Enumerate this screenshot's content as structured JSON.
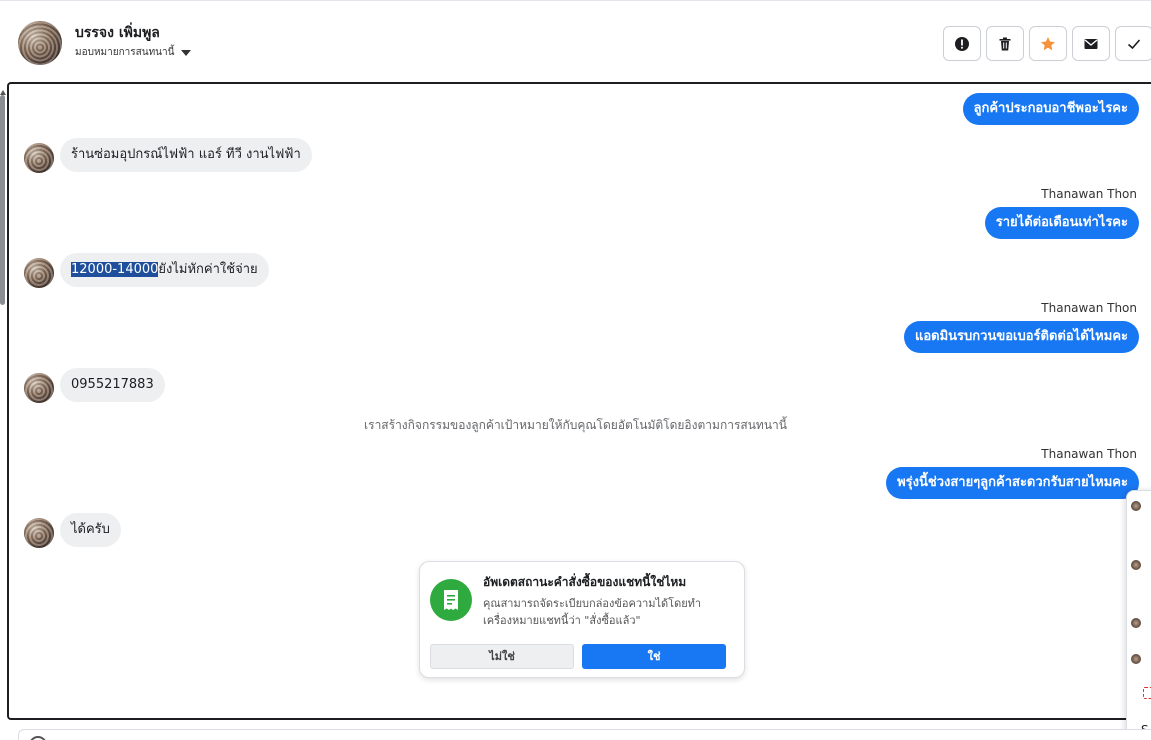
{
  "header": {
    "contact_name": "บรรจง เพิ่มพูล",
    "assign_label": "มอบหมายการสนทนานี้",
    "avatar_icon": "profile-photo",
    "tools": [
      {
        "icon": "alert-icon",
        "name": "report"
      },
      {
        "icon": "trash-icon",
        "name": "delete"
      },
      {
        "icon": "star-icon",
        "name": "star",
        "color": "#f7923a"
      },
      {
        "icon": "envelope-icon",
        "name": "mark-unread"
      },
      {
        "icon": "check-icon",
        "name": "done"
      }
    ]
  },
  "messages": [
    {
      "dir": "out",
      "text": "ลูกค้าประกอบอาชีพอะไรคะ"
    },
    {
      "dir": "in",
      "text": "ร้านซ่อมอุปกรณ์ไฟฟ้า แอร์ ทีวี งานไฟฟ้า"
    },
    {
      "dir": "out",
      "sender": "Thanawan Thon",
      "text": "รายได้ต่อเดือนเท่าไรคะ"
    },
    {
      "dir": "in",
      "highlight": "12000-14000",
      "text": "ยังไม่หักค่าใช้จ่าย"
    },
    {
      "dir": "out",
      "sender": "Thanawan Thon",
      "text": "แอดมินรบกวนขอเบอร์ติดต่อได้ไหมคะ"
    },
    {
      "dir": "in",
      "text": "0955217883"
    },
    {
      "dir": "system",
      "text": "เราสร้างกิจกรรมของลูกค้าเป้าหมายให้กับคุณโดยอัตโนมัติโดยอิงตามการสนทนานี้"
    },
    {
      "dir": "out",
      "sender": "Thanawan Thon",
      "text": "พรุ่งนี้ช่วงสายๆลูกค้าสะดวกรับสายไหมคะ"
    },
    {
      "dir": "in",
      "text": "ได้ครับ"
    }
  ],
  "order_prompt": {
    "title": "อัพเดตสถานะคำสั่งซื้อของแชทนี้ใช่ไหม",
    "description": "คุณสามารถจัดระเบียบกล่องข้อความได้โดยทำเครื่องหมายแชทนี้ว่า \"สั่งซื้อแล้ว\"",
    "no_label": "ไม่ใช่",
    "yes_label": "ใช่",
    "icon": "receipt-icon"
  },
  "side_popup": {
    "bottom_text": "S"
  },
  "colors": {
    "accent": "#1877f2",
    "incoming_bubble": "#eeeff1",
    "prompt_icon": "#2eaa3e"
  }
}
